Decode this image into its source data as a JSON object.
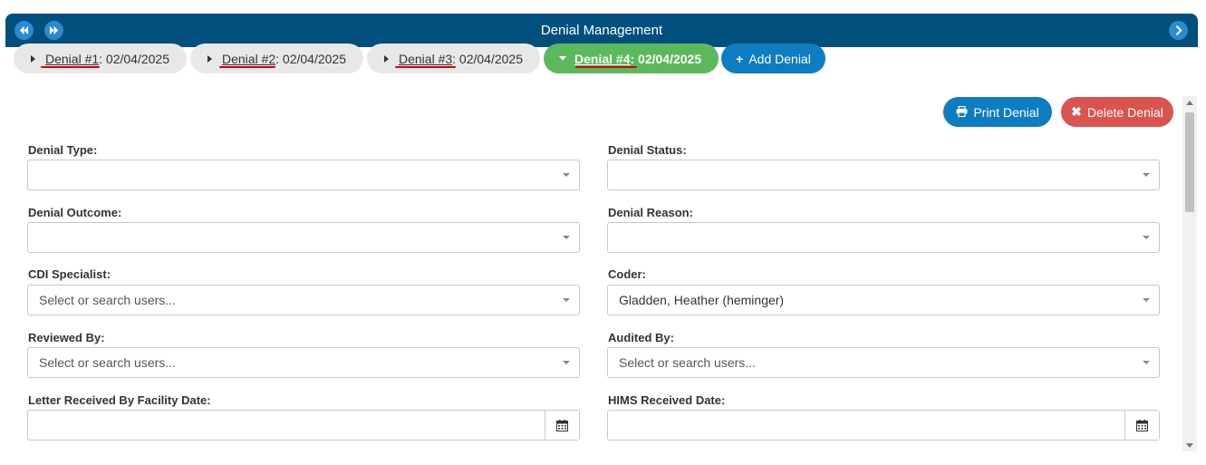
{
  "window": {
    "title": "Denial Management"
  },
  "nav": {
    "back_icon": "double-left-arrow-icon",
    "forward_icon": "double-right-arrow-icon",
    "expand_icon": "chevron-right-icon"
  },
  "tabs": [
    {
      "label": "Denial #1",
      "date": ": 02/04/2025",
      "active": false
    },
    {
      "label": "Denial #2",
      "date": ": 02/04/2025",
      "active": false
    },
    {
      "label": "Denial #3",
      "date": ": 02/04/2025",
      "active": false
    },
    {
      "label": "Denial #4",
      "date": ": 02/04/2025",
      "active": true
    }
  ],
  "actions": {
    "add_denial": "Add Denial",
    "print_denial": "Print Denial",
    "delete_denial": "Delete Denial"
  },
  "form": {
    "denial_type": {
      "label": "Denial Type:",
      "value": ""
    },
    "denial_status": {
      "label": "Denial Status:",
      "value": ""
    },
    "denial_outcome": {
      "label": "Denial Outcome:",
      "value": ""
    },
    "denial_reason": {
      "label": "Denial Reason:",
      "value": ""
    },
    "cdi_specialist": {
      "label": "CDI Specialist:",
      "placeholder": "Select or search users..."
    },
    "coder": {
      "label": "Coder:",
      "value": "Gladden, Heather (heminger)"
    },
    "reviewed_by": {
      "label": "Reviewed By:",
      "placeholder": "Select or search users..."
    },
    "audited_by": {
      "label": "Audited By:",
      "placeholder": "Select or search users..."
    },
    "letter_received_date": {
      "label": "Letter Received By Facility Date:",
      "value": ""
    },
    "hims_received_date": {
      "label": "HIMS Received Date:",
      "value": ""
    }
  },
  "colors": {
    "header": "#004f7c",
    "active_tab": "#5cb85c",
    "primary": "#0e7cc1",
    "danger": "#d9534f",
    "annotation": "#d8000c"
  }
}
